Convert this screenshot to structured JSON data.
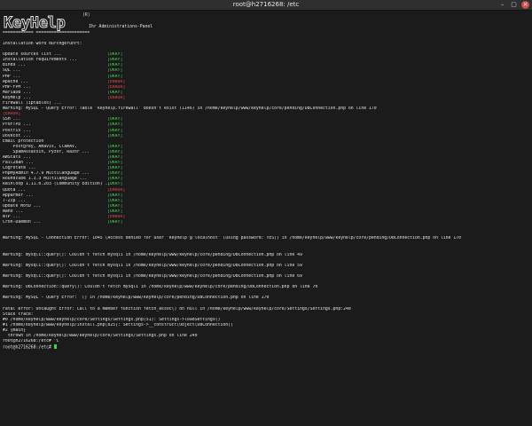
{
  "window": {
    "title": "root@h2716268: /etc"
  },
  "header": {
    "logo_text": "KeyHelp",
    "registered": "(R)",
    "panel_title": "Ihr Administrations-Panel",
    "separator": "============ ====================="
  },
  "colors": {
    "ok": "#3fd24a",
    "error": "#e34848",
    "text": "#e2e2e2",
    "background": "#1b1b1b"
  },
  "lines": [
    {
      "text": "Installation word durchgeführt:"
    },
    {
      "text": ""
    },
    {
      "label": "Update sources list ...",
      "status": "[OKAY]",
      "level": "ok"
    },
    {
      "label": "Installation requirements ...",
      "status": "[OKAY]",
      "level": "ok"
    },
    {
      "label": "Bind9 ...",
      "status": "[OKAY]",
      "level": "ok"
    },
    {
      "label": "SQL ...",
      "status": "[OKAY]",
      "level": "ok"
    },
    {
      "label": "PHP ...",
      "status": "[OKAY]",
      "level": "ok"
    },
    {
      "label": "Apache ...",
      "status": "[ERROR]",
      "level": "err"
    },
    {
      "label": "PHP-FPM ...",
      "status": "[ERROR]",
      "level": "err"
    },
    {
      "label": "MariaDB ...",
      "status": "[OKAY]",
      "level": "ok"
    },
    {
      "label": "KeyHelp ...",
      "status": "[ERROR]",
      "level": "err"
    },
    {
      "text": "Firewall (iptables) ..."
    },
    {
      "text": "Warning: MySQL - Query Error: Table 'keyhelp.firewall' doesn't exist (1146) in /home/keyhelp/www/keyhelp/core/pending/DBConnection.php on line 170"
    },
    {
      "text": "[ERROR]",
      "level": "err"
    },
    {
      "label": "SSH ...",
      "status": "[OKAY]",
      "level": "ok"
    },
    {
      "label": "ProFTPD ...",
      "status": "[OKAY]",
      "level": "ok"
    },
    {
      "label": "Postfix ...",
      "status": "[OKAY]",
      "level": "ok"
    },
    {
      "label": "Dovecot ...",
      "status": "[OKAY]",
      "level": "ok"
    },
    {
      "text": "Email protection"
    },
    {
      "label": "    Postgrey, Amavis, ClamAV,",
      "status": "[OKAY]",
      "level": "ok"
    },
    {
      "label": "    SpamAssassin, Pyzor, Razor ...",
      "status": "[OKAY]",
      "level": "ok"
    },
    {
      "label": "AWStats ...",
      "status": "[OKAY]",
      "level": "ok"
    },
    {
      "label": "Fail2Ban ...",
      "status": "[OKAY]",
      "level": "ok"
    },
    {
      "label": "Logrotate ...",
      "status": "[OKAY]",
      "level": "ok"
    },
    {
      "label": "PhpMyAdmin 4.7.9 Multilanguage ...",
      "status": "[OKAY]",
      "level": "ok"
    },
    {
      "label": "Roundcube 1.3.3 Multilanguage ...",
      "status": "[OKAY]",
      "level": "ok"
    },
    {
      "label": "Rainloop 1.11.0.203 (Community Edition) ...",
      "status": "[OKAY]",
      "level": "ok"
    },
    {
      "label": "Quota ...",
      "status": "[ERROR]",
      "level": "err"
    },
    {
      "label": "Apparmor ...",
      "status": "[OKAY]",
      "level": "ok"
    },
    {
      "label": "7-Zip ...",
      "status": "[OKAY]",
      "level": "ok"
    },
    {
      "label": "Update MotD ...",
      "status": "[OKAY]",
      "level": "ok"
    },
    {
      "label": "Nano ...",
      "status": "[OKAY]",
      "level": "ok"
    },
    {
      "label": "NTP ...",
      "status": "[ERROR]",
      "level": "err"
    },
    {
      "label": "Cron-Daemon ...",
      "status": "[OKAY]",
      "level": "ok"
    },
    {
      "text": ""
    },
    {
      "text": ""
    },
    {
      "text": "Warning: MySQL - Connection Error: 1045 (Access denied for user 'keyhelp'@'localhost' (using password: YES)) in /home/keyhelp/www/keyhelp/core/pending/DBConnection.php on line 170"
    },
    {
      "text": ""
    },
    {
      "text": ""
    },
    {
      "text": "Warning: mysqli::query(): Couldn't fetch mysqli in /home/keyhelp/www/keyhelp/core/pending/DBConnection.php on line 49"
    },
    {
      "text": ""
    },
    {
      "text": "Warning: mysqli::query(): Couldn't fetch mysqli in /home/keyhelp/www/keyhelp/core/pending/DBConnection.php on line 59"
    },
    {
      "text": ""
    },
    {
      "text": "Warning: mysqli::query(): Couldn't fetch mysqli in /home/keyhelp/www/keyhelp/core/pending/DBConnection.php on line 69"
    },
    {
      "text": ""
    },
    {
      "text": "Warning: DBConnection::query(): Couldn't fetch mysqli in /home/keyhelp/www/keyhelp/core/pending/DBConnection.php on line 70"
    },
    {
      "text": ""
    },
    {
      "text": "Warning: MySQL - Query Error:  () in /home/keyhelp/www/keyhelp/core/pending/DBConnection.php on line 170"
    },
    {
      "text": ""
    },
    {
      "text": "Fatal error: Uncaught Error: Call to a member function fetch_assoc() on null in /home/keyhelp/www/keyhelp/core/Settings/Settings.php:240"
    },
    {
      "text": "Stack trace:"
    },
    {
      "text": "#0 /home/keyhelp/www/keyhelp/core/Settings/Settings.php(51): Settings->loadSettings()"
    },
    {
      "text": "#1 /home/keyhelp/www/keyhelp/install.php(825): Settings->__construct(Object(DBConnection))"
    },
    {
      "text": "#2 {main}"
    },
    {
      "text": "  thrown in /home/keyhelp/www/keyhelp/core/Settings/Settings.php on line 240"
    },
    {
      "text": "root@h2716268:/etc# ^C"
    },
    {
      "text": "root@h2716268:/etc# ",
      "cursor": true
    }
  ]
}
